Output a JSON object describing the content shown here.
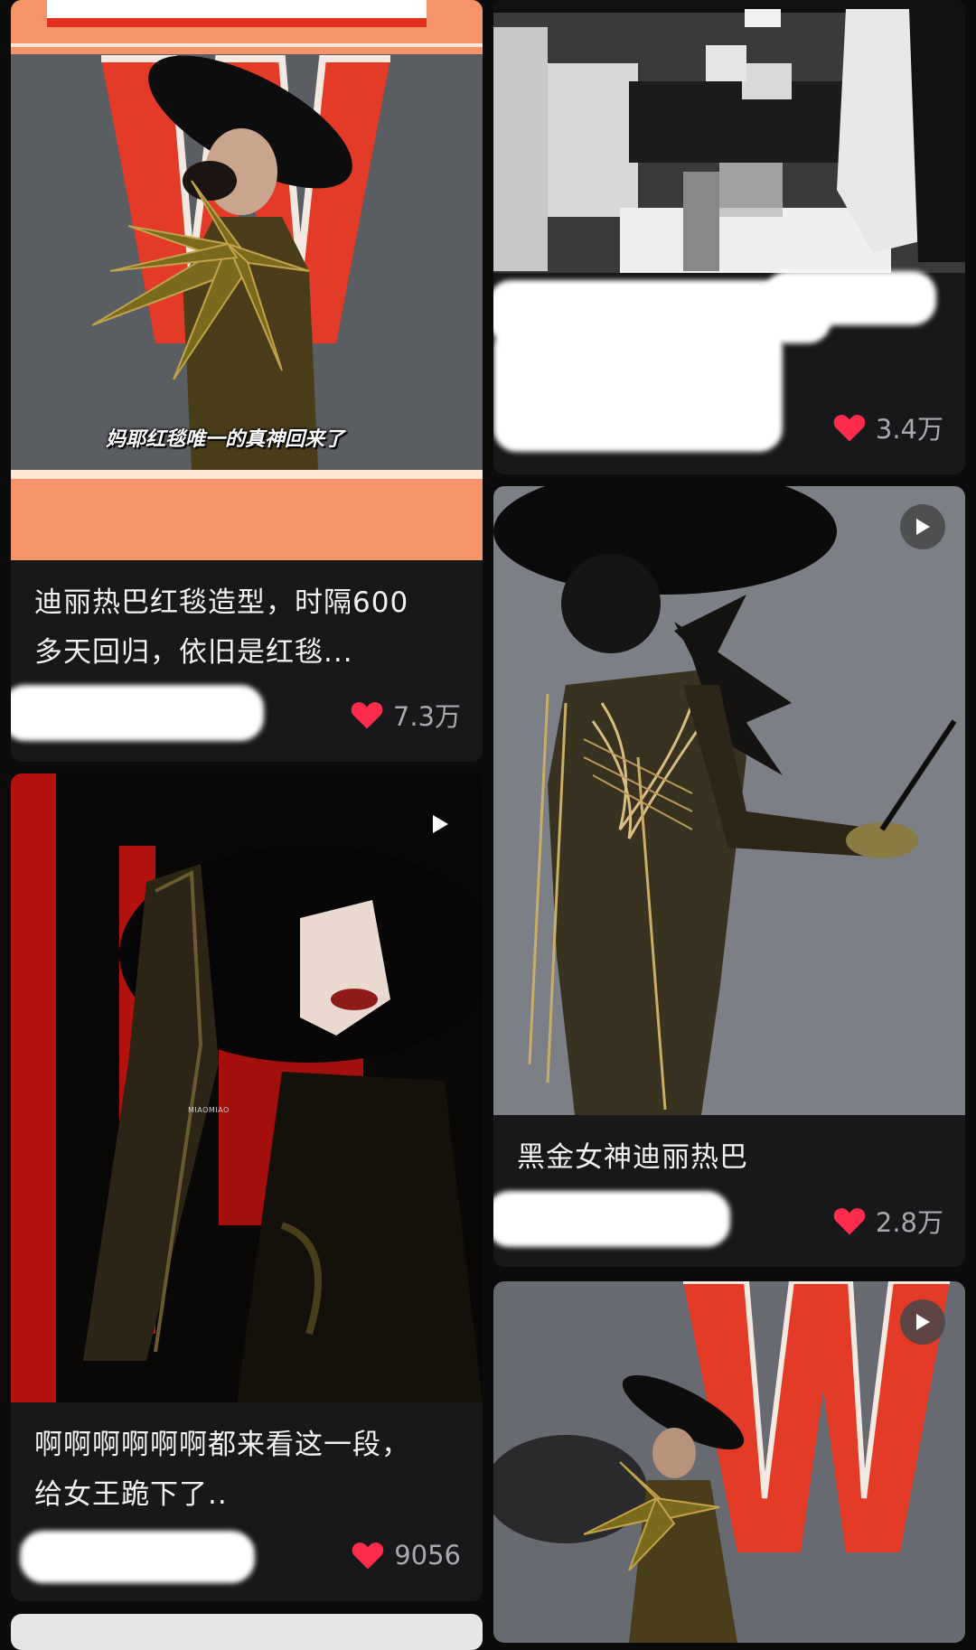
{
  "feed": {
    "cards": [
      {
        "id": "card1",
        "title": "迪丽热巴红毯造型，时隔600多天回归，依旧是红毯...",
        "title_line1": "迪丽热巴红毯造型，时隔600",
        "title_line2": "多天回归，依旧是红毯...",
        "overlay_caption": "妈耶红毯唯一的真神回来了",
        "likes": "7.3万",
        "has_video": false
      },
      {
        "id": "card2",
        "title": "",
        "likes": "3.4万",
        "has_video": false
      },
      {
        "id": "card3",
        "title": "黑金女神迪丽热巴",
        "likes": "2.8万",
        "has_video": true
      },
      {
        "id": "card4",
        "title_line1": "啊啊啊啊啊啊都来看这一段，",
        "title_line2": "给女王跪下了..",
        "watermark": "MIAOMIAO",
        "likes": "9056",
        "has_video": true
      },
      {
        "id": "card5",
        "title": "",
        "has_video": true
      }
    ]
  },
  "colors": {
    "background": "#0b0b0c",
    "card": "#18181a",
    "heart": "#ff2d4b",
    "like_text": "#a9a9ad",
    "title_text": "#f2f2f2",
    "red_wall": "#e0301e",
    "orange_frame": "#f5936a"
  },
  "icons": {
    "like": "heart-icon",
    "video": "play-icon"
  }
}
